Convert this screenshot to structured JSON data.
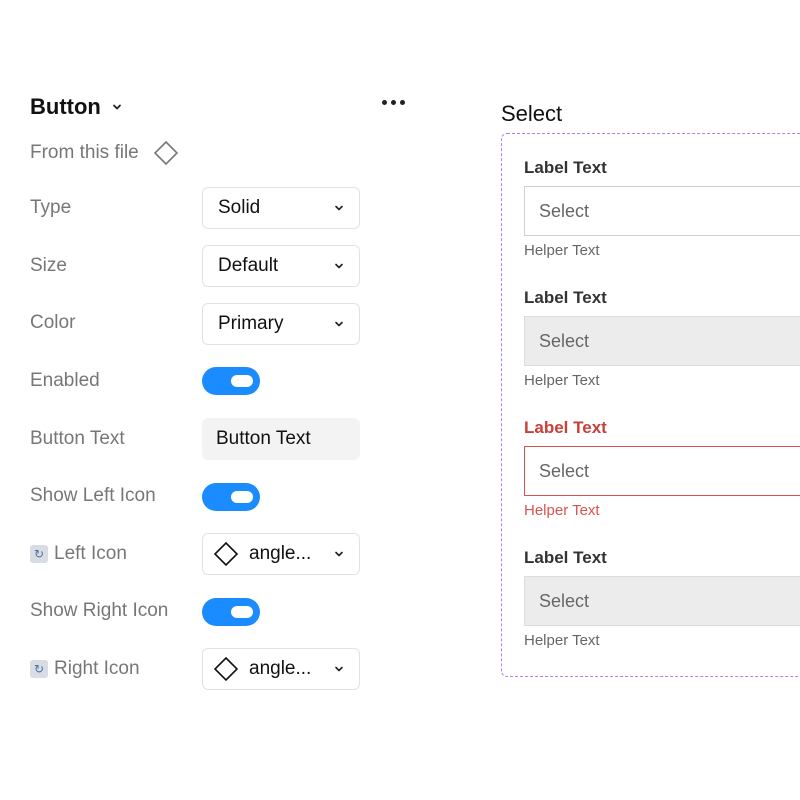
{
  "panel": {
    "title": "Button",
    "from_file": "From this file",
    "rows": {
      "type": {
        "label": "Type",
        "value": "Solid"
      },
      "size": {
        "label": "Size",
        "value": "Default"
      },
      "color": {
        "label": "Color",
        "value": "Primary"
      },
      "enabled": {
        "label": "Enabled",
        "on": true
      },
      "button_text": {
        "label": "Button Text",
        "value": "Button Text"
      },
      "show_left_icon": {
        "label": "Show Left Icon",
        "on": true
      },
      "left_icon": {
        "label": "Left Icon",
        "value": "angle..."
      },
      "show_right_icon": {
        "label": "Show Right Icon",
        "on": true
      },
      "right_icon": {
        "label": "Right Icon",
        "value": "angle..."
      }
    }
  },
  "preview": {
    "title": "Select",
    "fields": [
      {
        "label": "Label Text",
        "placeholder": "Select",
        "helper": "Helper Text",
        "state": "default"
      },
      {
        "label": "Label Text",
        "placeholder": "Select",
        "helper": "Helper Text",
        "state": "disabled"
      },
      {
        "label": "Label Text",
        "placeholder": "Select",
        "helper": "Helper Text",
        "state": "error"
      },
      {
        "label": "Label Text",
        "placeholder": "Select",
        "helper": "Helper Text",
        "state": "disabled"
      }
    ]
  },
  "colors": {
    "toggle_on": "#1a8cff",
    "error": "#d9534f",
    "frame_dash": "#b57ef0"
  }
}
